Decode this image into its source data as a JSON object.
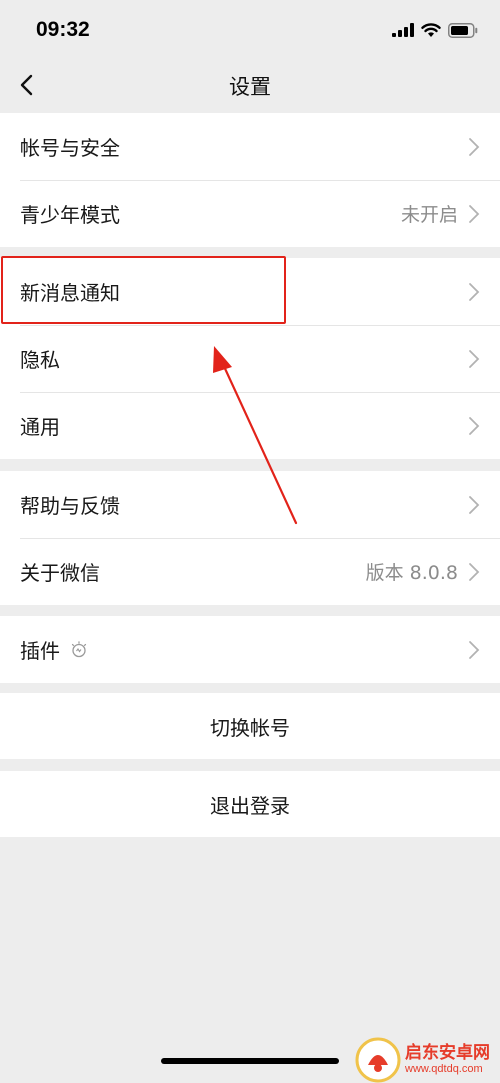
{
  "status_bar": {
    "time": "09:32"
  },
  "nav": {
    "title": "设置"
  },
  "groups": {
    "account": [
      {
        "label": "帐号与安全",
        "value": ""
      },
      {
        "label": "青少年模式",
        "value": "未开启"
      }
    ],
    "general": [
      {
        "label": "新消息通知",
        "value": ""
      },
      {
        "label": "隐私",
        "value": ""
      },
      {
        "label": "通用",
        "value": ""
      }
    ],
    "about": [
      {
        "label": "帮助与反馈",
        "value": ""
      },
      {
        "label": "关于微信",
        "value": "版本 8.0.8"
      }
    ],
    "plugins": [
      {
        "label": "插件",
        "value": ""
      }
    ]
  },
  "actions": {
    "switch_account": "切换帐号",
    "logout": "退出登录"
  },
  "watermark": {
    "brand": "启东安卓网",
    "url": "www.qdtdq.com"
  },
  "colors": {
    "background": "#ededed",
    "highlight": "#e2231a",
    "watermark": "#e63c2a"
  }
}
